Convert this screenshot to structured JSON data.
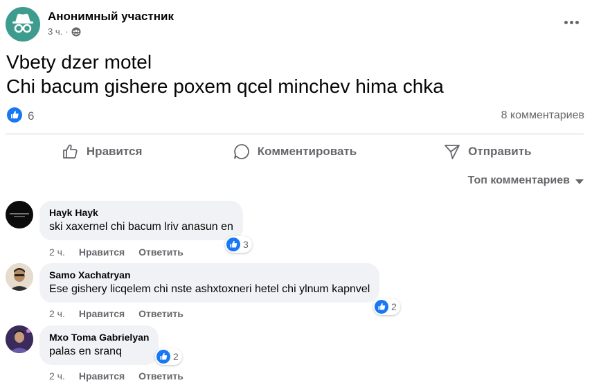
{
  "post": {
    "author": "Анонимный участник",
    "time": "3 ч.",
    "privacy_icon": "group-icon",
    "text_line1": "Vbety dzer motel",
    "text_line2": "Chi bacum gishere poxem qcel minchev hima chka",
    "like_count": "6",
    "comments_count": "8 комментариев"
  },
  "actions": {
    "like": "Нравится",
    "comment": "Комментировать",
    "share": "Отправить"
  },
  "sort_label": "Топ комментариев",
  "comments": [
    {
      "name": "Hayk Hayk",
      "text": "ski xaxernel chi bacum lriv anasun en",
      "time": "2 ч.",
      "like": "Нравится",
      "reply": "Ответить",
      "reactions": "3"
    },
    {
      "name": "Samo Xachatryan",
      "text": "Ese gishery licqelem chi nste ashxtoxneri hetel chi ylnum kapnvel",
      "time": "2 ч.",
      "like": "Нравится",
      "reply": "Ответить",
      "reactions": "2"
    },
    {
      "name": "Mxo Toma Gabrielyan",
      "text": "palas en sranq",
      "time": "2 ч.",
      "like": "Нравится",
      "reply": "Ответить",
      "reactions": "2"
    }
  ],
  "colors": {
    "accent": "#1877f2",
    "muted_text": "#65676b",
    "bubble_bg": "#f0f2f5",
    "anon_avatar": "#3e9c8e"
  }
}
